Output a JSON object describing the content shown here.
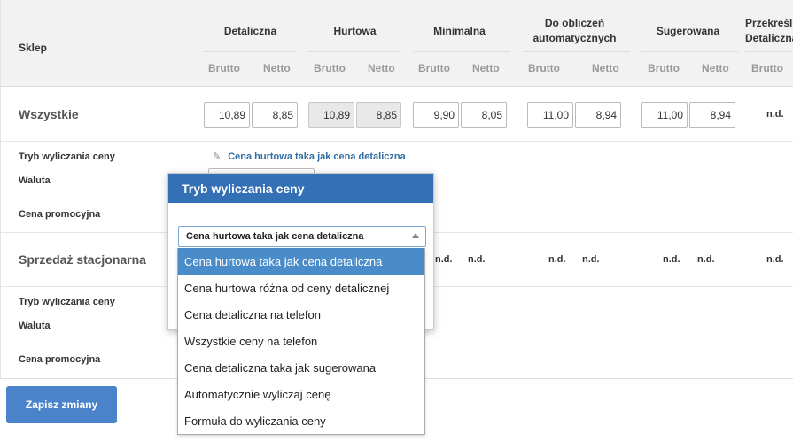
{
  "header": {
    "store_label": "Sklep",
    "groups": [
      {
        "label": "Detaliczna"
      },
      {
        "label": "Hurtowa"
      },
      {
        "label": "Minimalna"
      },
      {
        "label": "Do obliczeń automatycznych"
      },
      {
        "label": "Sugerowana"
      },
      {
        "label": "Przekreślona Detaliczna"
      }
    ],
    "brutto": "Brutto",
    "netto": "Netto"
  },
  "rows": [
    {
      "name": "Wszystkie",
      "prices": [
        "10,89",
        "8,85",
        "10,89",
        "8,85",
        "9,90",
        "8,05",
        "11,00",
        "8,94",
        "11,00",
        "8,94"
      ],
      "last_value": "n.d.",
      "fields": {
        "mode_label": "Tryb wyliczania ceny",
        "currency_label": "Waluta",
        "promo_label": "Cena promocyjna"
      },
      "mode_value": "Cena hurtowa taka jak cena detaliczna"
    },
    {
      "name": "Sprzedaż stacjonarna",
      "nd": "n.d.",
      "fields": {
        "mode_label": "Tryb wyliczania ceny",
        "currency_label": "Waluta",
        "promo_label": "Cena promocyjna"
      }
    }
  ],
  "save_button": "Zapisz zmiany",
  "popover": {
    "title": "Tryb wyliczania ceny",
    "selected": "Cena hurtowa taka jak cena detaliczna",
    "options": [
      "Cena hurtowa taka jak cena detaliczna",
      "Cena hurtowa różna od ceny detalicznej",
      "Cena detaliczna na telefon",
      "Wszystkie ceny na telefon",
      "Cena detaliczna taka jak sugerowana",
      "Automatycznie wyliczaj cenę",
      "Formuła do wyliczania ceny"
    ]
  },
  "colors": {
    "accent": "#3470b5",
    "button": "#4a83c9",
    "selected_option": "#4a8cc9",
    "link": "#2e6da4"
  },
  "icons": {
    "edit": "pencil-icon",
    "select": "caret-up-icon"
  }
}
